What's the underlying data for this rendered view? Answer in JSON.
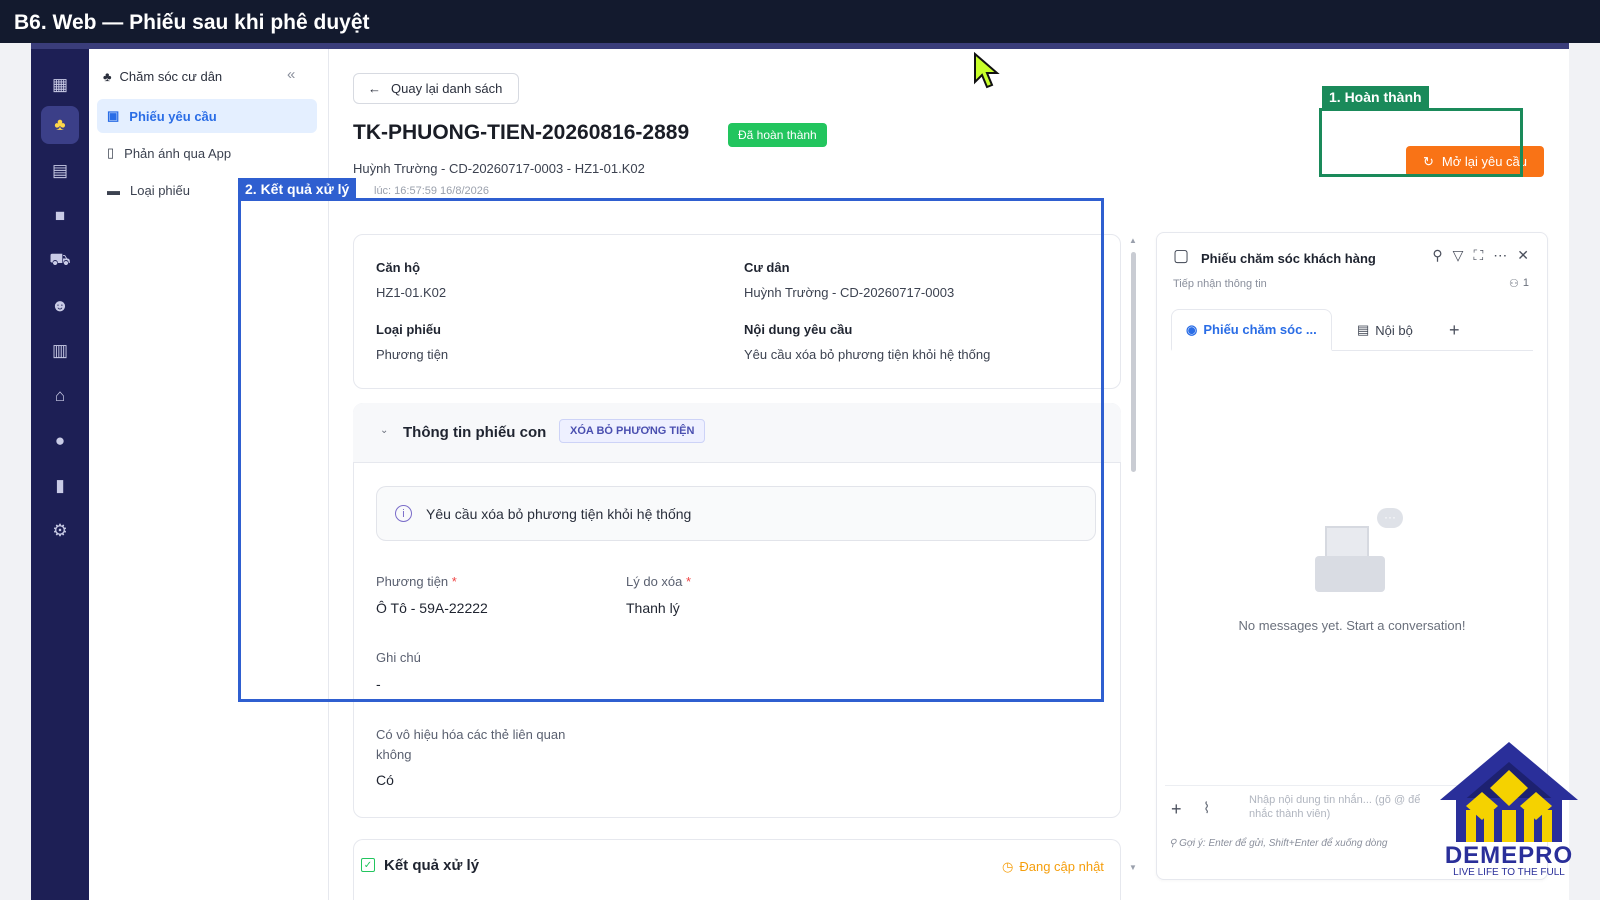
{
  "banner": {
    "title": "B6. Web — Phiếu sau khi phê duyệt"
  },
  "sidenav": {
    "header": "Chăm sóc cư dân",
    "items": [
      {
        "label": "Phiếu yêu cầu",
        "active": true
      },
      {
        "label": "Phản ánh qua App"
      },
      {
        "label": "Loại phiếu"
      }
    ]
  },
  "iconbar": {
    "icons": [
      "building-icon",
      "care-icon",
      "calculator-icon",
      "briefcase-icon",
      "car-icon",
      "users-icon",
      "apartment-icon",
      "store-icon",
      "person-icon",
      "chart-icon",
      "gear-icon"
    ]
  },
  "header": {
    "back_label": "Quay lại danh sách",
    "ticket_id": "TK-PHUONG-TIEN-20260816-2889",
    "status": "Đã hoàn thành",
    "subtitle": "Huỳnh Trường - CD-20260717-0003 - HZ1-01.K02",
    "timestamp": "lúc: 16:57:59 16/8/2026",
    "reopen_label": "Mở lại yêu cầu"
  },
  "info_card": {
    "can_ho_label": "Căn hộ",
    "can_ho_value": "HZ1-01.K02",
    "cu_dan_label": "Cư dân",
    "cu_dan_value": "Huỳnh Trường - CD-20260717-0003",
    "loai_phieu_label": "Loại phiếu",
    "loai_phieu_value": "Phương tiện",
    "noi_dung_label": "Nội dung yêu cầu",
    "noi_dung_value": "Yêu cầu xóa bỏ phương tiện khỏi hệ thống"
  },
  "child_ticket": {
    "title": "Thông tin phiếu con",
    "tag": "XÓA BỎ PHƯƠNG TIỆN",
    "notice": "Yêu cầu xóa bỏ phương tiện khỏi hệ thống",
    "phuong_tien_label": "Phương tiện",
    "phuong_tien_value": "Ô Tô - 59A-22222",
    "ly_do_label": "Lý do xóa",
    "ly_do_value": "Thanh lý",
    "ghi_chu_label": "Ghi chú",
    "ghi_chu_value": "-",
    "vo_hieu_label": "Có vô hiệu hóa các thẻ liên quan không",
    "vo_hieu_value": "Có"
  },
  "result": {
    "title": "Kết quả xử lý",
    "status": "Đang cập nhật"
  },
  "chat": {
    "title": "Phiếu chăm sóc khách hàng",
    "subtitle": "Tiếp nhận thông tin",
    "member_count": "1",
    "tab_active": "Phiếu chăm sóc ...",
    "tab_internal": "Nội bộ",
    "empty": "No messages yet. Start a conversation!",
    "input_placeholder": "Nhập nội dung tin nhắn... (gõ @ để nhắc thành viên)",
    "hint": "Gợi ý: Enter để gửi, Shift+Enter để xuống dòng"
  },
  "annotations": {
    "box1": "1. Hoàn thành",
    "box2": "2. Kết quả xử lý",
    "box1_color": "#1a8a5a",
    "box2_color": "#2f5fd0"
  },
  "logo": {
    "brand": "DEMEPRO",
    "tagline": "LIVE LIFE TO THE FULL"
  }
}
